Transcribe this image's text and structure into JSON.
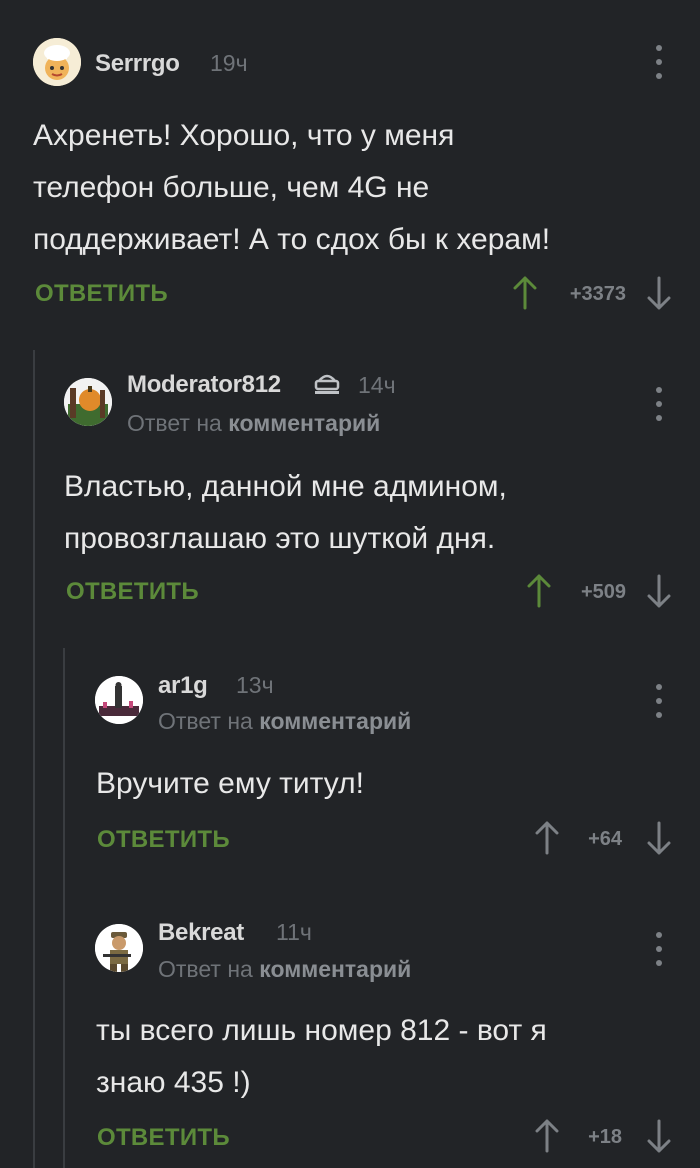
{
  "reply_prefix": "Ответ на",
  "reply_target": "комментарий",
  "reply_label": "ОТВЕТИТЬ",
  "colors": {
    "background": "#222427",
    "reply_green": "#5c8a3a",
    "upvote_active": "#5c8a3a",
    "muted": "#7d8186"
  },
  "comments": [
    {
      "author": "Serrrgo",
      "time": "19ч",
      "text_lines": [
        "Ахренеть! Хорошо, что у меня",
        "телефон больше, чем 4G не",
        "поддерживает! А то сдох бы к херам!"
      ],
      "rating": "+3373",
      "upvoted": true
    },
    {
      "author": "Moderator812",
      "badge_icon": "crown-icon",
      "time": "14ч",
      "text_lines": [
        "Властью, данной мне админом,",
        "провозглашаю это шуткой дня."
      ],
      "rating": "+509",
      "upvoted": true
    },
    {
      "author": "ar1g",
      "time": "13ч",
      "text_lines": [
        "Вручите ему титул!"
      ],
      "rating": "+64",
      "upvoted": false
    },
    {
      "author": "Bekreat",
      "time": "11ч",
      "text_lines": [
        "ты всего лишь номер 812 - вот я",
        "знаю 435 !)"
      ],
      "rating": "+18",
      "upvoted": false
    }
  ]
}
